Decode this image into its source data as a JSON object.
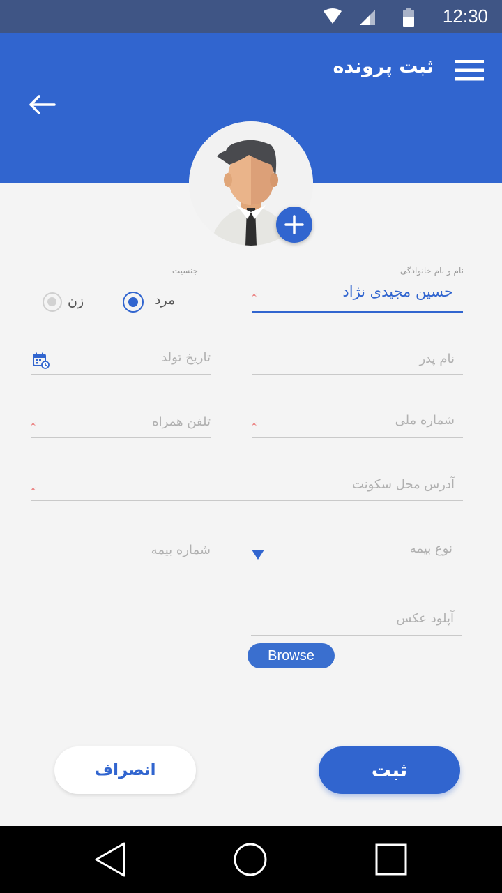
{
  "status_bar": {
    "time": "12:30"
  },
  "header": {
    "title": "ثبت پرونده"
  },
  "form": {
    "full_name": {
      "label": "نام و نام خانوادگی",
      "value": "حسین مجیدی نژاد"
    },
    "gender": {
      "label": "جنسیت",
      "male": "مرد",
      "female": "زن",
      "selected": "مرد"
    },
    "father_name": {
      "placeholder": "نام پدر"
    },
    "birth_date": {
      "placeholder": "تاریخ تولد"
    },
    "national_id": {
      "placeholder": "شماره ملی"
    },
    "mobile": {
      "placeholder": "تلفن همراه"
    },
    "address": {
      "placeholder": "آدرس محل سکونت"
    },
    "insurance_type": {
      "placeholder": "نوع بیمه"
    },
    "insurance_number": {
      "placeholder": "شماره بیمه"
    },
    "photo_upload": {
      "placeholder": "آپلود عکس",
      "browse_label": "Browse"
    },
    "required_mark": "*"
  },
  "actions": {
    "submit_label": "ثبت",
    "cancel_label": "انصراف"
  },
  "colors": {
    "primary": "#3165cf",
    "status_bar": "#3f5585",
    "required": "#e85a5a"
  }
}
